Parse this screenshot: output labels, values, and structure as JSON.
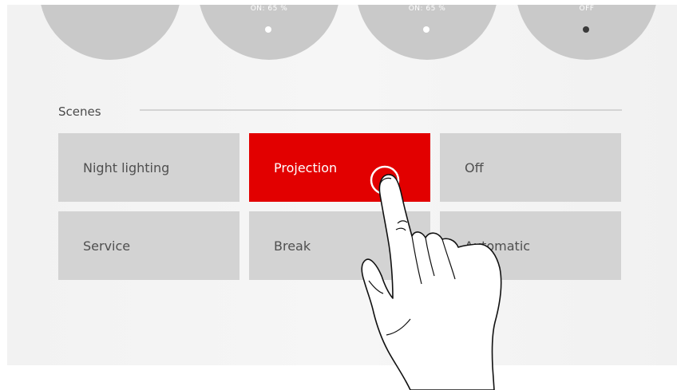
{
  "dials": [
    {
      "status": "",
      "dot": "none"
    },
    {
      "status": "ON: 65 %",
      "dot": "light"
    },
    {
      "status": "ON: 65 %",
      "dot": "light"
    },
    {
      "status": "OFF",
      "dot": "dark"
    }
  ],
  "scenes": {
    "title": "Scenes",
    "buttons": [
      {
        "label": "Night lighting",
        "active": false
      },
      {
        "label": "Projection",
        "active": true
      },
      {
        "label": "Off",
        "active": false
      },
      {
        "label": "Service",
        "active": false
      },
      {
        "label": "Break",
        "active": false
      },
      {
        "label": "Automatic",
        "active": false
      }
    ]
  },
  "colors": {
    "accent": "#e20000",
    "button": "#d3d3d3",
    "dial": "#c9c9c9"
  },
  "overlay": {
    "icon": "pointing-hand-icon"
  }
}
